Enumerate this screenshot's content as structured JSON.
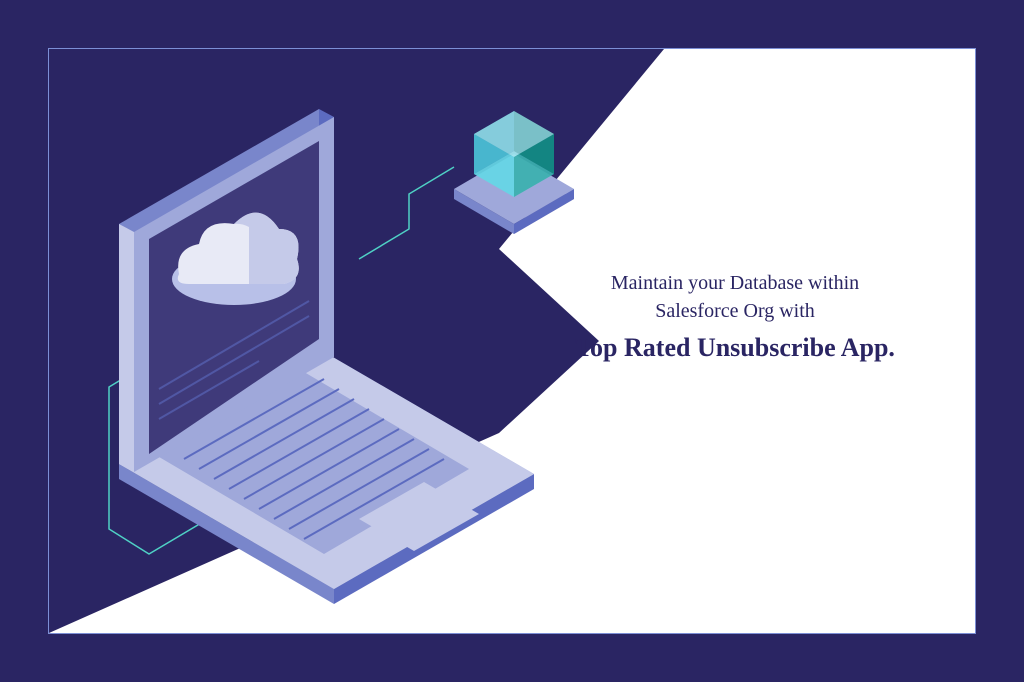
{
  "text": {
    "subtitle_line1": "Maintain your Database within",
    "subtitle_line2": "Salesforce Org with",
    "title": "Top Rated Unsubscribe App."
  },
  "colors": {
    "background": "#2a2563",
    "accent_teal": "#4fd1c5",
    "text": "#2a2563",
    "laptop_light": "#c5cae9",
    "laptop_mid": "#9fa8da",
    "laptop_dark": "#5c6bc0",
    "screen": "#3f3a7a",
    "cloud_light": "#e8eaf6",
    "cloud_dark": "#b8c0e8",
    "cube_teal": "#4dd0e1",
    "cube_dark": "#26a69a"
  }
}
